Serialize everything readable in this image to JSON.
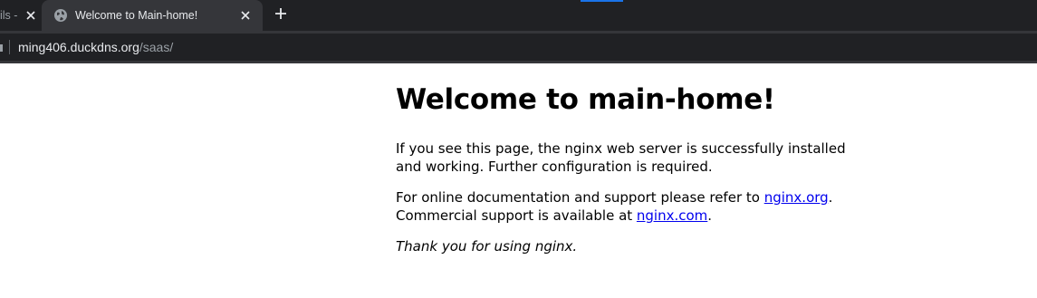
{
  "browser": {
    "accent_color": "#1a73e8",
    "tabs": [
      {
        "title": "ils -",
        "icon": "close-icon",
        "active": false
      },
      {
        "title": "Welcome to Main-home!",
        "favicon": "globe-icon",
        "icon": "close-icon",
        "active": true
      }
    ],
    "new_tab_icon": "plus-icon",
    "address_bar": {
      "host": "ming406.duckdns.org",
      "path": "/saas/"
    }
  },
  "page": {
    "heading": "Welcome to main-home!",
    "paragraph1": "If you see this page, the nginx web server is successfully installed and working. Further configuration is required.",
    "paragraph2": {
      "prefix": "For online documentation and support please refer to ",
      "link1": "nginx.org",
      "middle": ".\nCommercial support is available at ",
      "link2": "nginx.com",
      "suffix": "."
    },
    "thanks": "Thank you for using nginx.",
    "link_color": "#0000ee"
  }
}
